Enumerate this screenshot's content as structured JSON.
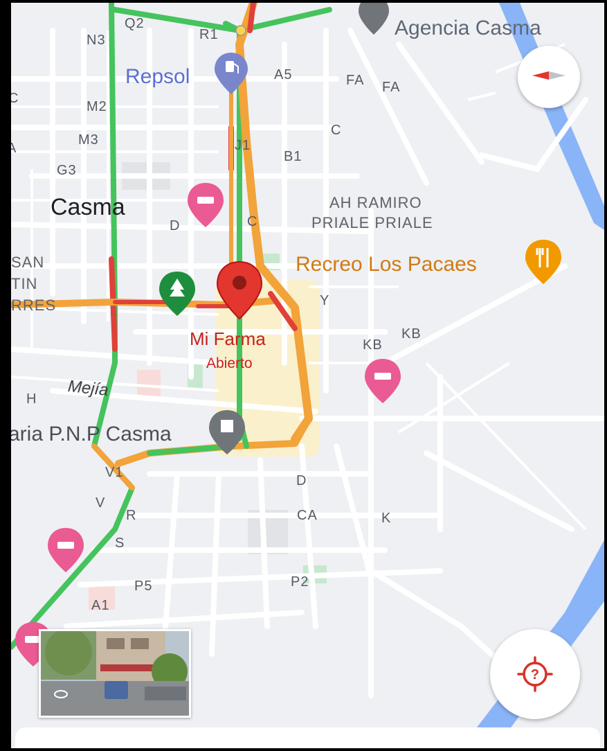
{
  "map": {
    "town": "Casma",
    "pois": {
      "agencia": "Agencia Casma",
      "repsol": "Repsol",
      "recreo": "Recreo Los Pacaes",
      "mifarma": "Mi Farma",
      "mifarma_status": "Abierto",
      "comisaria": "aria P.N.P Casma"
    },
    "neighborhood": [
      "AH RAMIRO",
      "PRIALE PRIALE"
    ],
    "district_partial": [
      "SAN",
      "TIN",
      "RRES"
    ],
    "street": "Mejía",
    "blocks": [
      "Q2",
      "N3",
      "R1",
      "A5",
      "FA",
      "FA",
      "M2",
      "C",
      "M3",
      "J1",
      "B1",
      "G3",
      "D",
      "C",
      "Y",
      "KB",
      "KB",
      "H",
      "V1",
      "D",
      "V",
      "R",
      "CA",
      "K",
      "S",
      "P5",
      "P2",
      "A1"
    ],
    "left_edge": [
      "C",
      "A"
    ]
  },
  "controls": {
    "compass": "compass-icon",
    "locate": "my-location-icon",
    "locate_glyph": "?"
  },
  "colors": {
    "traffic_green": "#45c35d",
    "traffic_orange": "#f2a33a",
    "traffic_red": "#e0403a",
    "water": "#8ab4f8",
    "selected_pin": "#e2362f",
    "hotel_pin": "#ea5a93",
    "park_pin": "#1e8e3e",
    "restaurant_pin": "#f29900",
    "fuel_pin": "#7986cb",
    "gov_pin": "#70757a"
  }
}
